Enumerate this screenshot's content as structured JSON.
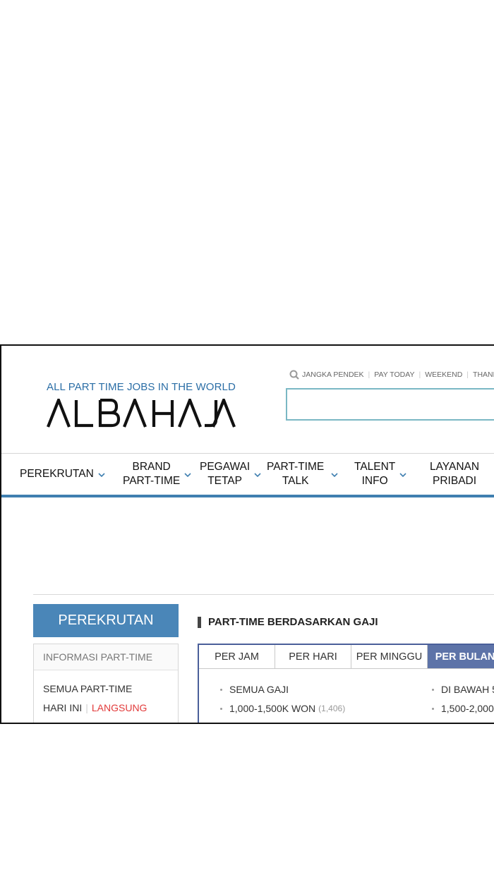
{
  "header": {
    "tagline": "ALL PART TIME JOBS IN THE WORLD",
    "logo_text": "ALBAHAJA",
    "quick_links": [
      "JANGKA PENDEK",
      "PAY TODAY",
      "WEEKEND",
      "THANKSG"
    ],
    "search": {
      "value": "",
      "placeholder": ""
    }
  },
  "nav": {
    "items": [
      {
        "label": "PEREKRUTAN"
      },
      {
        "label_line1": "BRAND",
        "label_line2": "PART-TIME"
      },
      {
        "label_line1": "PEGAWAI",
        "label_line2": "TETAP"
      },
      {
        "label_line1": "PART-TIME",
        "label_line2": "TALK"
      },
      {
        "label_line1": "TALENT",
        "label_line2": "INFO"
      },
      {
        "label_line1": "LAYANAN",
        "label_line2": "PRIBADI"
      }
    ]
  },
  "sidebar": {
    "title": "PEREKRUTAN",
    "subhead": "INFORMASI PART-TIME",
    "links": {
      "all": "SEMUA PART-TIME",
      "today": "HARI INI",
      "live": "LANGSUNG"
    }
  },
  "main": {
    "section_title": "PART-TIME BERDASARKAN GAJI",
    "tabs": [
      "PER JAM",
      "PER HARI",
      "PER MINGGU",
      "PER BULAN"
    ],
    "active_tab": "PER BULAN",
    "ranges": [
      {
        "label": "SEMUA GAJI",
        "count": ""
      },
      {
        "label": "1,000-1,500K WON",
        "count": "(1,406)"
      },
      {
        "label": "DI BAWAH 5",
        "count": ""
      },
      {
        "label": "1,500-2,000",
        "count": ""
      }
    ]
  },
  "colors": {
    "accent_blue": "#4a86b8",
    "tagline_blue": "#2b6ea6",
    "nav_underline": "#3f7fb0",
    "active_tab": "#5d73a8",
    "live_red": "#e23b3b",
    "search_border": "#7ab8c4"
  },
  "icons": [
    "search-icon",
    "chevron-down-icon"
  ]
}
